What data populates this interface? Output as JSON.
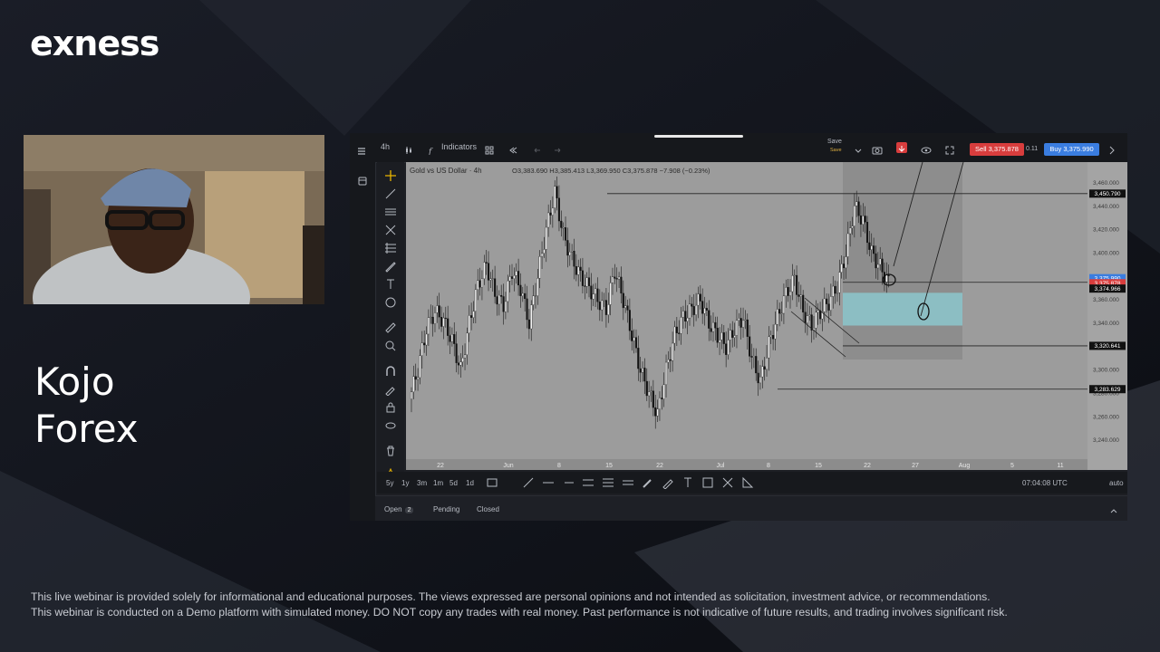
{
  "brand": {
    "logo": "exness"
  },
  "host": {
    "line1": "Kojo",
    "line2": "Forex"
  },
  "disclaimer": {
    "line1": "This live webinar is provided solely for informational and educational purposes. The views expressed are personal opinions and not intended as solicitation, investment advice, or recommendations.",
    "line2": "This webinar is conducted on a Demo platform with simulated money. DO NOT copy any trades with real money. Past performance is not indicative of future results, and trading involves significant risk."
  },
  "platform": {
    "timeframe": "4h",
    "indicators_label": "Indicators",
    "save_label": "Save",
    "save_sub": "Save",
    "sell_label": "Sell 3,375.878",
    "spread": "0.11",
    "buy_label": "Buy 3,375.990",
    "symbol": "Gold vs US Dollar · 4h",
    "ohlc": "O3,383.690 H3,385.413 L3,369.950 C3,375.878 −7.908 (−0.23%)",
    "ranges": [
      "5y",
      "1y",
      "3m",
      "1m",
      "5d",
      "1d"
    ],
    "clock": "07:04:08 UTC",
    "auto_label": "auto",
    "order_tabs": {
      "open": "Open",
      "open_count": "2",
      "pending": "Pending",
      "closed": "Closed"
    }
  },
  "chart_data": {
    "type": "candlestick",
    "title": "Gold vs US Dollar",
    "interval": "4h",
    "y_ticks": [
      "3,460.000",
      "3,440.000",
      "3,420.000",
      "3,400.000",
      "3,380.000",
      "3,360.000",
      "3,340.000",
      "3,320.000",
      "3,300.000",
      "3,280.000",
      "3,260.000",
      "3,240.000"
    ],
    "x_ticks": [
      "22",
      "Jun",
      "8",
      "15",
      "22",
      "Jul",
      "8",
      "15",
      "22",
      "27",
      "Aug",
      "5",
      "11"
    ],
    "price_labels": [
      {
        "value": "3,450.790",
        "color": "#111111"
      },
      {
        "value": "3,375.990",
        "color": "#3a7de0"
      },
      {
        "value": "3,375.878",
        "color": "#d83d3d"
      },
      {
        "value": "3,374.966",
        "color": "#111111"
      },
      {
        "value": "3,320.641",
        "color": "#111111"
      },
      {
        "value": "3,283.629",
        "color": "#111111"
      }
    ],
    "approx_closes": [
      3275,
      3300,
      3335,
      3350,
      3342,
      3325,
      3300,
      3340,
      3372,
      3390,
      3365,
      3355,
      3385,
      3370,
      3340,
      3380,
      3420,
      3452,
      3415,
      3395,
      3380,
      3370,
      3360,
      3352,
      3385,
      3360,
      3330,
      3300,
      3280,
      3262,
      3300,
      3330,
      3345,
      3352,
      3360,
      3340,
      3330,
      3320,
      3335,
      3345,
      3310,
      3290,
      3322,
      3345,
      3365,
      3378,
      3350,
      3338,
      3350,
      3358,
      3372,
      3400,
      3440,
      3428,
      3400,
      3388,
      3375
    ]
  },
  "colors": {
    "sell": "#d83d3d",
    "buy": "#3a7de0",
    "zone": "#8ccfd6",
    "chart_bg": "#9c9c9c"
  }
}
